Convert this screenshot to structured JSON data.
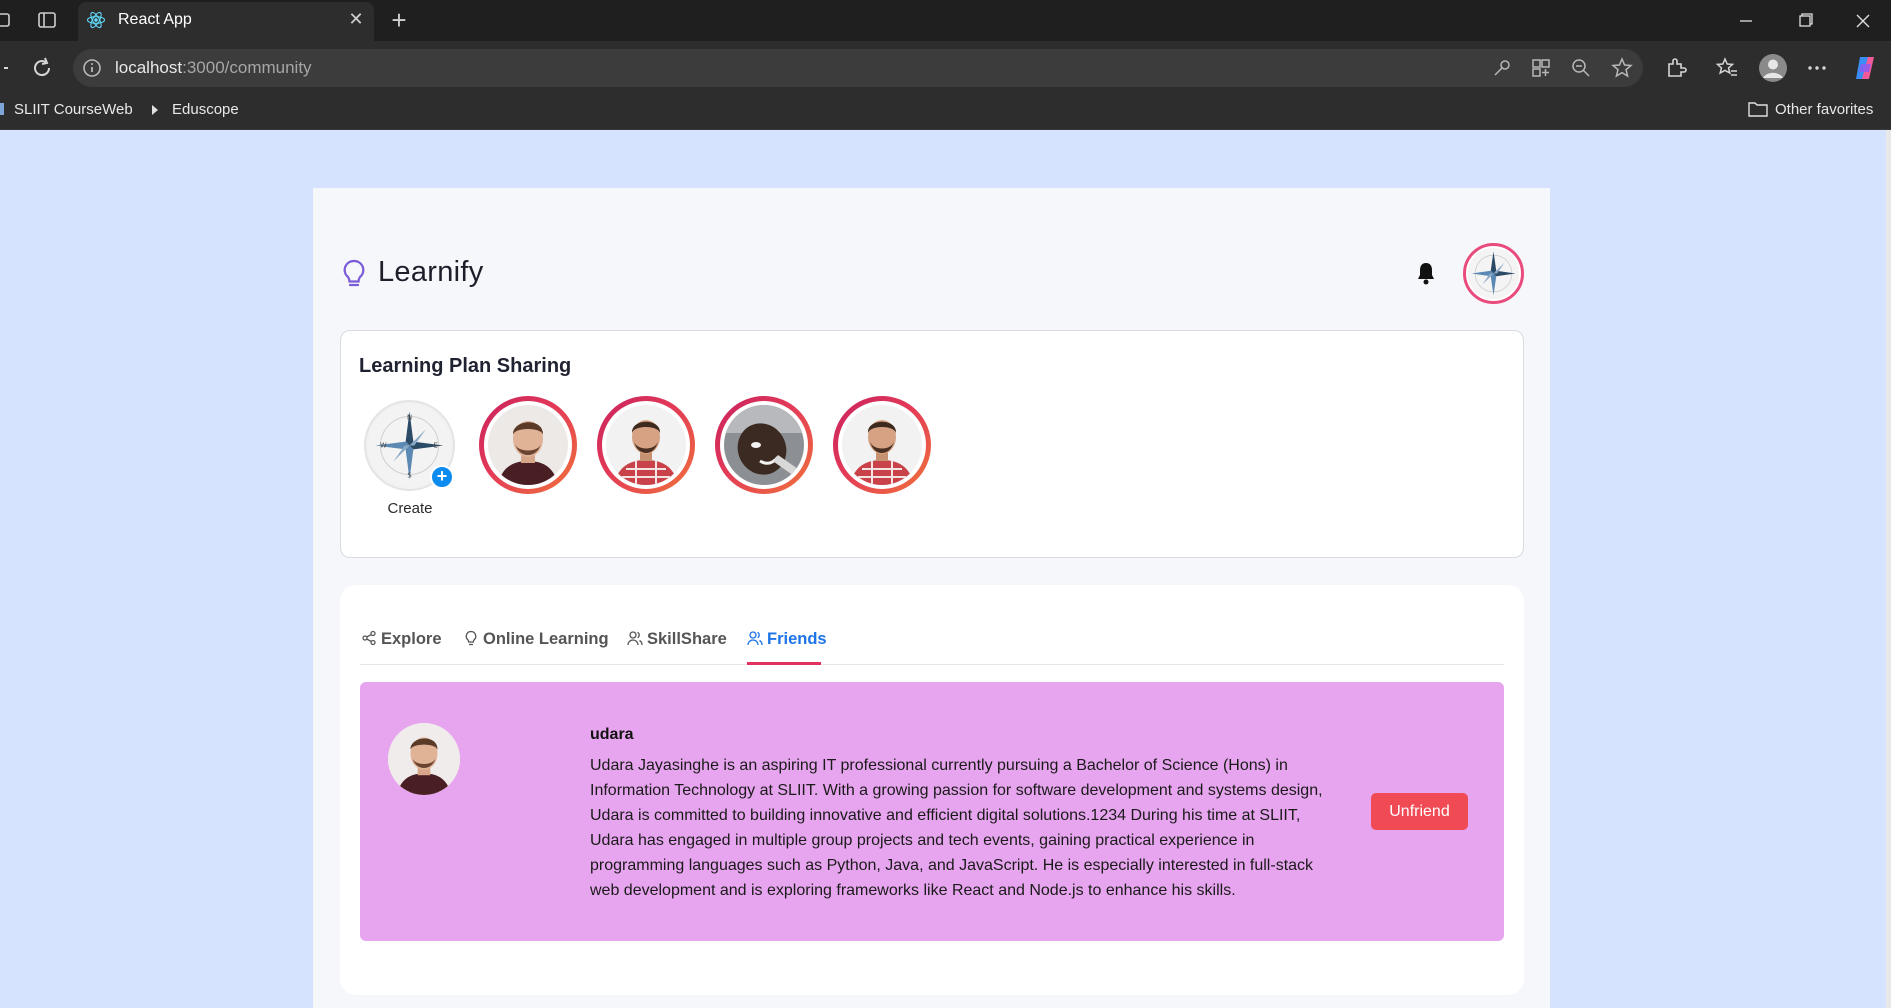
{
  "browser": {
    "tab_title": "React App",
    "url_host": "localhost",
    "url_rest": ":3000/community",
    "bookmarks": [
      "SLIIT CourseWeb",
      "Eduscope"
    ],
    "other_favorites": "Other favorites"
  },
  "app": {
    "name": "Learnify",
    "accent": "#7b5cd6"
  },
  "stories": {
    "heading": "Learning Plan Sharing",
    "create_label": "Create",
    "items": [
      {
        "avatar": "man-portrait-1"
      },
      {
        "avatar": "man-plaid-shirt"
      },
      {
        "avatar": "man-selfie"
      },
      {
        "avatar": "man-plaid-shirt"
      }
    ]
  },
  "tabs": [
    {
      "label": "Explore",
      "icon": "share-icon",
      "active": false
    },
    {
      "label": "Online Learning",
      "icon": "lightbulb-icon",
      "active": false
    },
    {
      "label": "SkillShare",
      "icon": "users-icon",
      "active": false
    },
    {
      "label": "Friends",
      "icon": "users-icon",
      "active": true
    }
  ],
  "friends": [
    {
      "name": "udara",
      "bio": "Udara Jayasinghe is an aspiring IT professional currently pursuing a Bachelor of Science (Hons) in Information Technology at SLIIT. With a growing passion for software development and systems design, Udara is committed to building innovative and efficient digital solutions.1234 During his time at SLIIT, Udara has engaged in multiple group projects and tech events, gaining practical experience in programming languages such as Python, Java, and JavaScript. He is especially interested in full-stack web development and is exploring frameworks like React and Node.js to enhance his skills.",
      "action_label": "Unfriend",
      "card_color": "#e8a5ef",
      "action_color": "#f04a55"
    }
  ]
}
